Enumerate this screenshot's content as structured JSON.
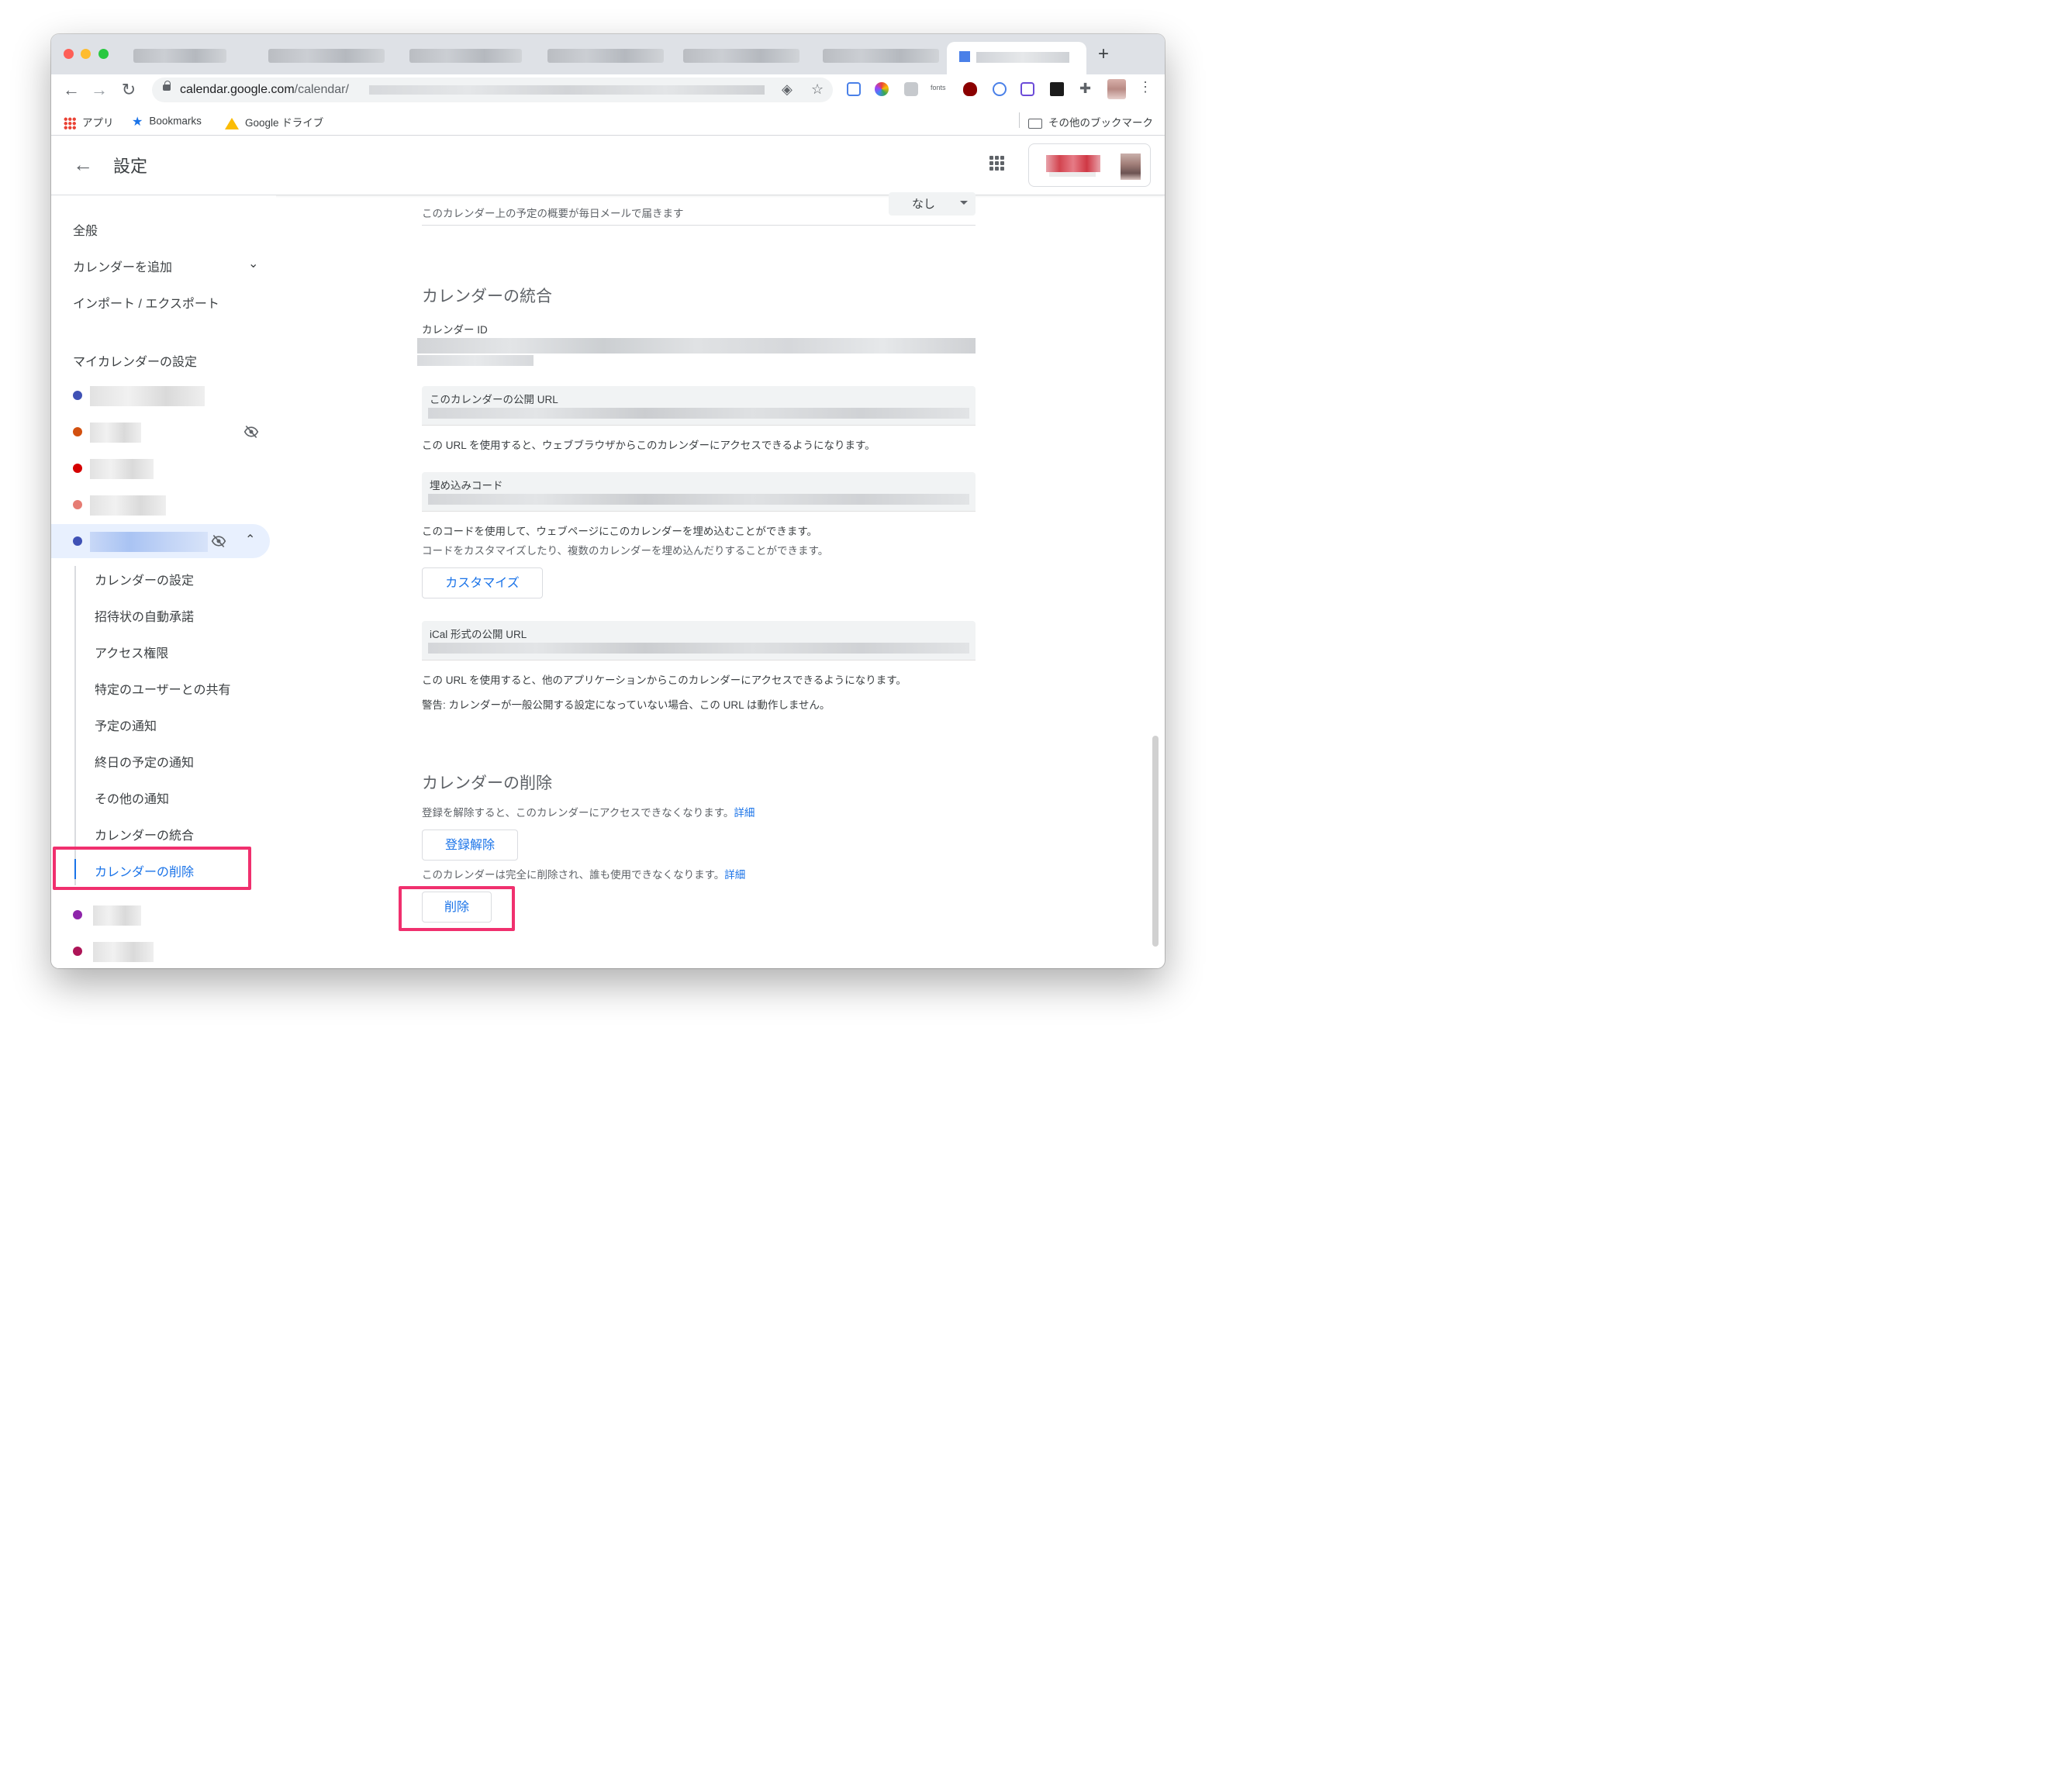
{
  "browser": {
    "url_host": "calendar.google.com",
    "url_path": "/calendar/",
    "bookmarks": [
      "アプリ",
      "Bookmarks",
      "Google ドライブ"
    ],
    "other_bookmarks": "その他のブックマーク",
    "ext_fonts_label": "fonts"
  },
  "header": {
    "title": "設定"
  },
  "sidebar": {
    "general": "全般",
    "add_calendar": "カレンダーを追加",
    "import_export": "インポート / エクスポート",
    "my_calendars_heading": "マイカレンダーの設定",
    "calendar_colors": [
      "#3f51b5",
      "#d2500f",
      "#d50000",
      "#e67c73",
      "#3f51b5",
      "#8e24aa",
      "#ad1457"
    ],
    "sub_items": [
      "カレンダーの設定",
      "招待状の自動承諾",
      "アクセス権限",
      "特定のユーザーとの共有",
      "予定の通知",
      "終日の予定の通知",
      "その他の通知",
      "カレンダーの統合",
      "カレンダーの削除"
    ]
  },
  "content": {
    "daily_agenda_desc": "このカレンダー上の予定の概要が毎日メールで届きます",
    "daily_agenda_value": "なし",
    "integrate_heading": "カレンダーの統合",
    "calendar_id_label": "カレンダー ID",
    "public_url_label": "このカレンダーの公開 URL",
    "public_url_desc": "この URL を使用すると、ウェブブラウザからこのカレンダーにアクセスできるようになります。",
    "embed_label": "埋め込みコード",
    "embed_desc": "このコードを使用して、ウェブページにこのカレンダーを埋め込むことができます。",
    "embed_desc2": "コードをカスタマイズしたり、複数のカレンダーを埋め込んだりすることができます。",
    "customize_button": "カスタマイズ",
    "ical_label": "iCal 形式の公開 URL",
    "ical_desc": "この URL を使用すると、他のアプリケーションからこのカレンダーにアクセスできるようになります。",
    "ical_warning": "警告: カレンダーが一般公開する設定になっていない場合、この URL は動作しません。",
    "delete_heading": "カレンダーの削除",
    "unsubscribe_desc": "登録を解除すると、このカレンダーにアクセスできなくなります。",
    "details_link": "詳細",
    "unsubscribe_button": "登録解除",
    "delete_desc": "このカレンダーは完全に削除され、誰も使用できなくなります。",
    "delete_button": "削除"
  },
  "colors": {
    "accent": "#1a73e8",
    "highlight": "#f0306e"
  }
}
